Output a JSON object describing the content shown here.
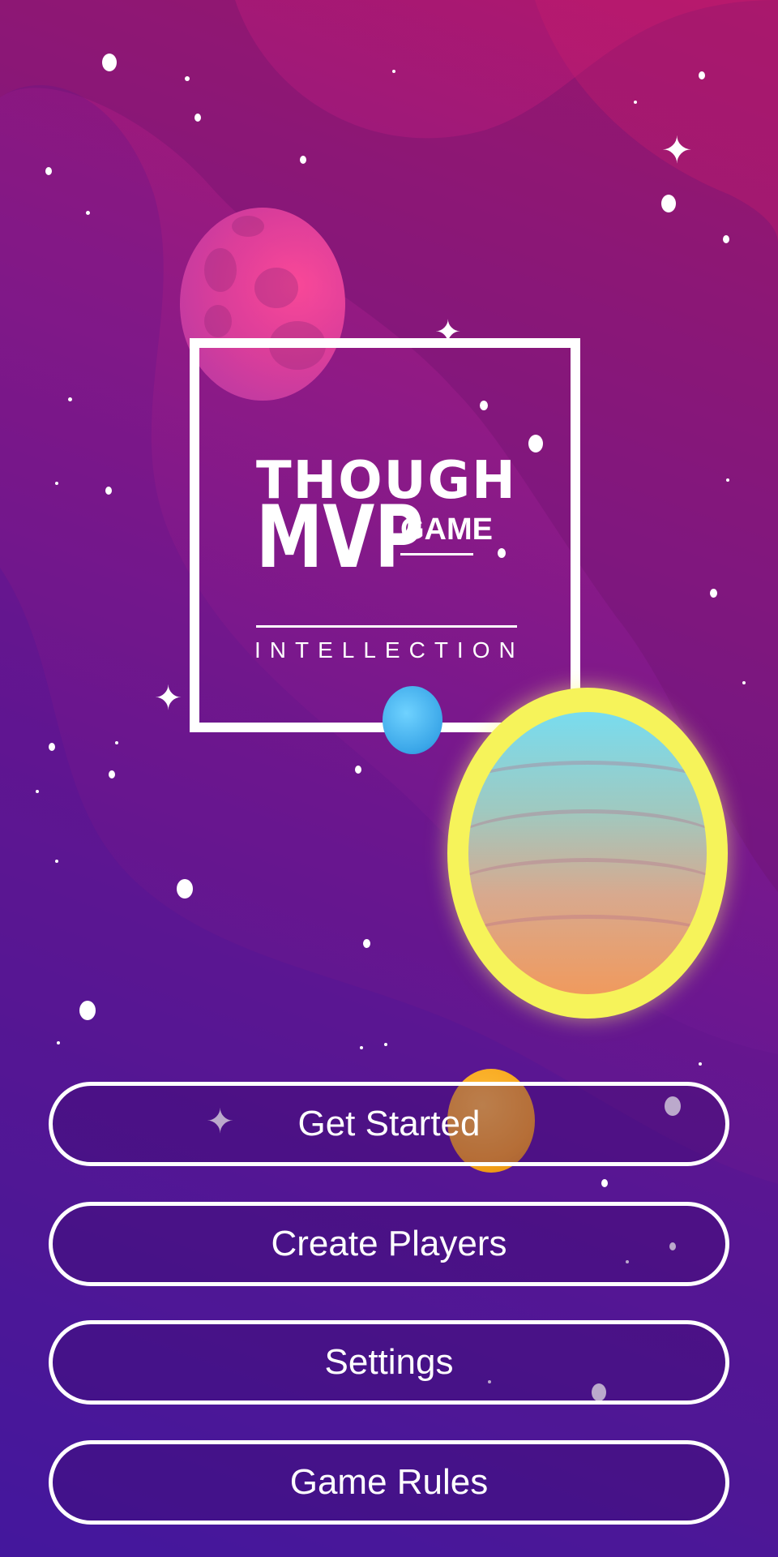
{
  "logo": {
    "title_top": "THOUGH",
    "title_main": "MVP",
    "title_sub": "GAME",
    "tagline": "INTELLECTION"
  },
  "menu": {
    "get_started_label": "Get Started",
    "create_players_label": "Create Players",
    "settings_label": "Settings",
    "game_rules_label": "Game Rules"
  },
  "decor": {
    "icons": [
      "sparkle-star-icon",
      "planet-icon"
    ],
    "colors": {
      "background_top": "#b0186c",
      "background_bottom": "#3a1ba6",
      "accent_yellow": "#f6f35a",
      "accent_pink": "#ff4b9a",
      "button_border": "#ffffff"
    }
  }
}
